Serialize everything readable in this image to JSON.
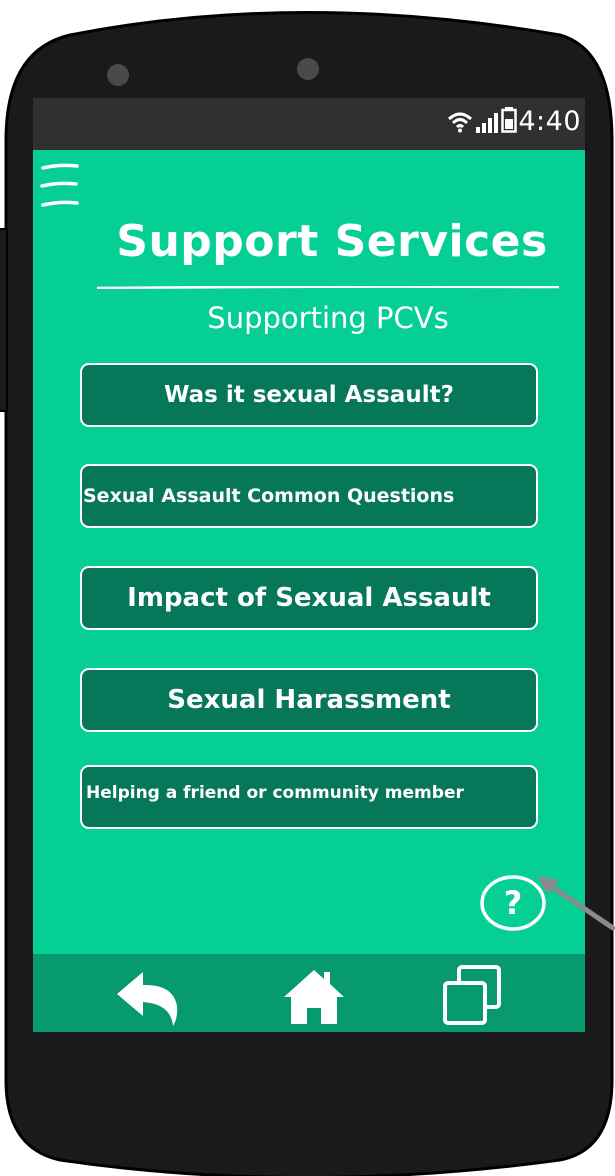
{
  "status_bar": {
    "time": "4:40",
    "icons": [
      "wifi-icon",
      "signal-icon",
      "battery-icon"
    ]
  },
  "header": {
    "menu_icon": "hamburger-menu-icon",
    "title": "Support Services",
    "subtitle": "Supporting PCVs"
  },
  "menu": {
    "items": [
      {
        "label": "Was it sexual Assault?"
      },
      {
        "label": "Sexual Assault Common Questions"
      },
      {
        "label": "Impact of Sexual Assault"
      },
      {
        "label": "Sexual Harassment"
      },
      {
        "label": "Helping a friend or community member"
      }
    ]
  },
  "help": {
    "icon": "help-icon",
    "label": "?"
  },
  "nav_bar": {
    "items": [
      "back-icon",
      "home-icon",
      "recent-apps-icon"
    ]
  },
  "colors": {
    "screen_background": "#06cf96",
    "button_background": "#07775a",
    "nav_bar_background": "#069a6e",
    "status_bar_background": "#303030",
    "phone_body": "#1a1a1a",
    "text": "#ffffff"
  }
}
